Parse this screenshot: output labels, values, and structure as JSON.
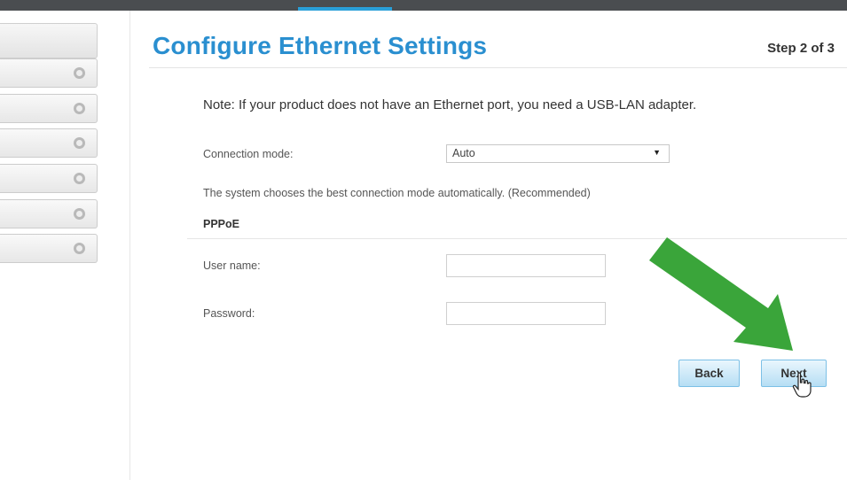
{
  "page": {
    "title": "Configure Ethernet Settings",
    "step": "Step 2 of 3",
    "note": "Note: If your product does not have an Ethernet port, you need a USB-LAN adapter."
  },
  "sidebar": {
    "items": [
      {
        "icon": "circle-icon"
      },
      {
        "icon": "circle-icon"
      },
      {
        "icon": "circle-icon"
      },
      {
        "icon": "circle-icon"
      },
      {
        "icon": "circle-icon"
      },
      {
        "icon": "circle-icon"
      }
    ]
  },
  "form": {
    "connection_mode_label": "Connection mode:",
    "connection_mode_value": "Auto",
    "connection_mode_description": "The system chooses the best connection mode automatically. (Recommended)",
    "pppoe_section_title": "PPPoE",
    "username_label": "User name:",
    "username_value": "",
    "password_label": "Password:",
    "password_value": ""
  },
  "buttons": {
    "back": "Back",
    "next": "Next"
  },
  "colors": {
    "title": "#2a8fd0",
    "topbar": "#4a4d50",
    "topbar_accent": "#2a9fd8",
    "button_fill": "#b6def4",
    "button_border": "#7cc0e6",
    "overlay_arrow": "#3aa53a"
  },
  "overlay": {
    "arrow_icon": "green-pointer-arrow",
    "cursor_icon": "hand-cursor-icon"
  }
}
